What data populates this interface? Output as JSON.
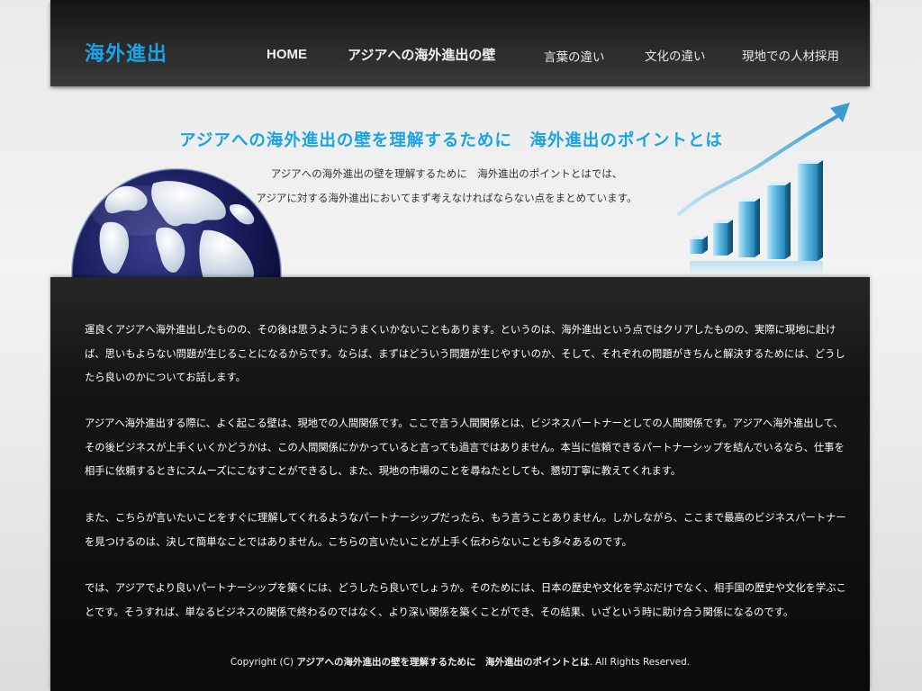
{
  "site": {
    "logo": "海外進出"
  },
  "nav": {
    "items": [
      {
        "label": "HOME"
      },
      {
        "label": "アジアへの海外進出の壁"
      },
      {
        "label": "言葉の違い"
      },
      {
        "label": "文化の違い"
      },
      {
        "label": "現地での人材採用"
      }
    ]
  },
  "hero": {
    "title": "アジアへの海外進出の壁を理解するために　海外進出のポイントとは",
    "desc_line1": "アジアへの海外進出の壁を理解するために　海外進出のポイントとはでは、",
    "desc_line2": "アジアに対する海外進出においてまず考えなければならない点をまとめています。"
  },
  "content": {
    "paragraphs": [
      "運良くアジアへ海外進出したものの、その後は思うようにうまくいかないこともあります。というのは、海外進出という点ではクリアしたものの、実際に現地に赴けば、思いもよらない問題が生じることになるからです。ならば、まずはどういう問題が生じやすいのか、そして、それぞれの問題がきちんと解決するためには、どうしたら良いのかについてお話します。",
      "アジアへ海外進出する際に、よく起こる壁は、現地での人間関係です。ここで言う人間関係とは、ビジネスパートナーとしての人間関係です。アジアへ海外進出して、その後ビジネスが上手くいくかどうかは、この人間関係にかかっていると言っても過言ではありません。本当に信頼できるパートナーシップを結んでいるなら、仕事を相手に依頼するときにスムーズにこなすことができるし、また、現地の市場のことを尋ねたとしても、懇切丁寧に教えてくれます。",
      "また、こちらが言いたいことをすぐに理解してくれるようなパートナーシップだったら、もう言うことありません。しかしながら、ここまで最高のビジネスパートナーを見つけるのは、決して簡単なことではありません。こちらの言いたいことが上手く伝わらないことも多々あるのです。",
      "では、アジアでより良いパートナーシップを築くには、どうしたら良いでしょうか。そのためには、日本の歴史や文化を学ぶだけでなく、相手国の歴史や文化を学ぶことです。そうすれば、単なるビジネスの関係で終わるのではなく、より深い関係を築くことができ、その結果、いざという時に助け合う関係になるのです。"
    ]
  },
  "footer": {
    "prefix": "Copyright (C) ",
    "site_name": "アジアへの海外進出の壁を理解するために　海外進出のポイントとは",
    "suffix": ".  All Rights Reserved."
  },
  "colors": {
    "accent": "#1aa3e6",
    "header_bg": "#262626",
    "content_bg": "#111111"
  },
  "icons": {
    "globe": "globe-icon",
    "growth_chart": "bar-chart-arrow-icon"
  }
}
